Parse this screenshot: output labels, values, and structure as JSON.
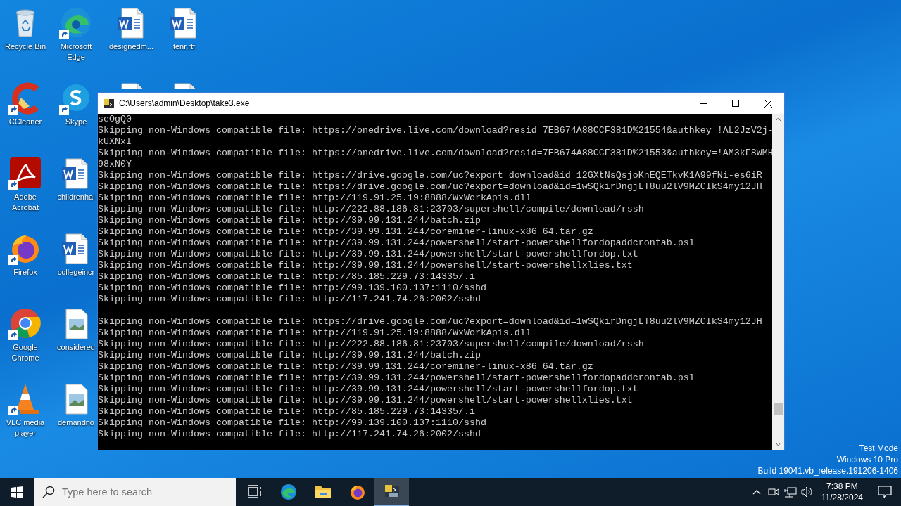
{
  "desktop_columns": [
    [
      {
        "kind": "recycle",
        "label": "Recycle Bin",
        "shortcut": false
      },
      {
        "kind": "ccleaner",
        "label": "CCleaner",
        "shortcut": true
      },
      {
        "kind": "acrobat",
        "label": "Adobe Acrobat",
        "shortcut": true
      },
      {
        "kind": "firefox",
        "label": "Firefox",
        "shortcut": true
      },
      {
        "kind": "chrome",
        "label": "Google Chrome",
        "shortcut": true
      },
      {
        "kind": "vlc",
        "label": "VLC media player",
        "shortcut": true
      }
    ],
    [
      {
        "kind": "edge",
        "label": "Microsoft Edge",
        "shortcut": true
      },
      {
        "kind": "skype",
        "label": "Skype",
        "shortcut": true
      },
      {
        "kind": "word",
        "label": "childrenhal",
        "shortcut": false
      },
      {
        "kind": "word",
        "label": "collegeincr",
        "shortcut": false
      },
      {
        "kind": "image",
        "label": "considered",
        "shortcut": false
      },
      {
        "kind": "image",
        "label": "demandno",
        "shortcut": false
      }
    ],
    [
      {
        "kind": "word",
        "label": "designedm...",
        "shortcut": false
      },
      {
        "kind": "word",
        "shortcut": false
      }
    ],
    [
      {
        "kind": "word",
        "label": "tenr.rtf",
        "shortcut": false
      },
      {
        "kind": "word",
        "shortcut": false
      }
    ]
  ],
  "console": {
    "title": "C:\\Users\\admin\\Desktop\\take3.exe",
    "blocks": [
      [
        "seOgQ0",
        "Skipping non-Windows compatible file: https://onedrive.live.com/download?resid=7EB674A88CCF381D%21554&authkey=!AL2JzV2j-",
        "kUXNxI",
        "Skipping non-Windows compatible file: https://onedrive.live.com/download?resid=7EB674A88CCF381D%21553&authkey=!AM3kF8WMH",
        "98xN0Y",
        "Skipping non-Windows compatible file: https://drive.google.com/uc?export=download&id=12GXtNsQsjoKnEQETkvK1A99fNi-es6iR",
        "Skipping non-Windows compatible file: https://drive.google.com/uc?export=download&id=1wSQkirDngjLT8uu2lV9MZCIkS4my12JH",
        "Skipping non-Windows compatible file: http://119.91.25.19:8888/WxWorkApis.dll",
        "Skipping non-Windows compatible file: http://222.88.186.81:23703/supershell/compile/download/rssh",
        "Skipping non-Windows compatible file: http://39.99.131.244/batch.zip",
        "Skipping non-Windows compatible file: http://39.99.131.244/coreminer-linux-x86_64.tar.gz",
        "Skipping non-Windows compatible file: http://39.99.131.244/powershell/start-powershellfordopaddcrontab.psl",
        "Skipping non-Windows compatible file: http://39.99.131.244/powershell/start-powershellfordop.txt",
        "Skipping non-Windows compatible file: http://39.99.131.244/powershell/start-powershellxlies.txt",
        "Skipping non-Windows compatible file: http://85.185.229.73:14335/.i",
        "Skipping non-Windows compatible file: http://99.139.100.137:1110/sshd",
        "Skipping non-Windows compatible file: http://117.241.74.26:2002/sshd"
      ],
      [
        "Skipping non-Windows compatible file: https://drive.google.com/uc?export=download&id=1wSQkirDngjLT8uu2lV9MZCIkS4my12JH",
        "Skipping non-Windows compatible file: http://119.91.25.19:8888/WxWorkApis.dll",
        "Skipping non-Windows compatible file: http://222.88.186.81:23703/supershell/compile/download/rssh",
        "Skipping non-Windows compatible file: http://39.99.131.244/batch.zip",
        "Skipping non-Windows compatible file: http://39.99.131.244/coreminer-linux-x86_64.tar.gz",
        "Skipping non-Windows compatible file: http://39.99.131.244/powershell/start-powershellfordopaddcrontab.psl",
        "Skipping non-Windows compatible file: http://39.99.131.244/powershell/start-powershellfordop.txt",
        "Skipping non-Windows compatible file: http://39.99.131.244/powershell/start-powershellxlies.txt",
        "Skipping non-Windows compatible file: http://85.185.229.73:14335/.i",
        "Skipping non-Windows compatible file: http://99.139.100.137:1110/sshd",
        "Skipping non-Windows compatible file: http://117.241.74.26:2002/sshd"
      ]
    ]
  },
  "desktop_notice": [
    "Test Mode",
    "Windows 10 Pro",
    "Build 19041.vb_release.191206-1406"
  ],
  "taskbar": {
    "search": {
      "placeholder": "Type here to search"
    },
    "apps": [
      {
        "kind": "taskview",
        "selected": false
      },
      {
        "kind": "edge",
        "selected": false
      },
      {
        "kind": "explorer",
        "selected": false
      },
      {
        "kind": "firefox",
        "selected": false
      },
      {
        "kind": "console",
        "selected": true
      }
    ],
    "time": "7:38 PM",
    "date": "11/28/2024"
  }
}
